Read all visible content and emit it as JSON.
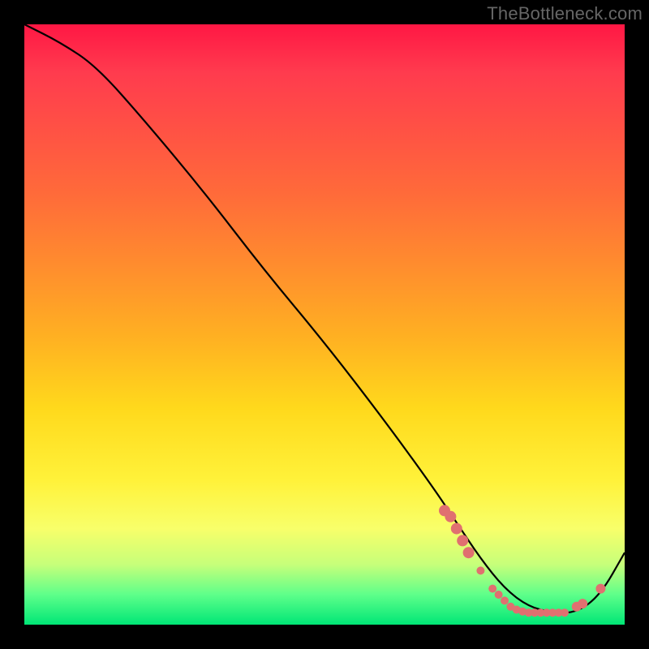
{
  "watermark": "TheBottleneck.com",
  "chart_data": {
    "type": "line",
    "title": "",
    "xlabel": "",
    "ylabel": "",
    "xlim": [
      0,
      100
    ],
    "ylim": [
      0,
      100
    ],
    "grid": false,
    "series": [
      {
        "name": "curve",
        "x": [
          0,
          6,
          12,
          20,
          30,
          40,
          50,
          60,
          68,
          72,
          76,
          80,
          84,
          88,
          92,
          96,
          100
        ],
        "y": [
          100,
          97,
          93,
          84,
          72,
          59,
          47,
          34,
          23,
          17,
          11,
          6,
          3,
          2,
          2,
          5,
          12
        ]
      }
    ],
    "markers": {
      "name": "highlight-dots",
      "x": [
        70,
        71,
        72,
        73,
        74,
        76,
        78,
        79,
        80,
        81,
        82,
        83,
        84,
        85,
        86,
        87,
        88,
        89,
        90,
        92,
        93,
        96
      ],
      "y": [
        19,
        18,
        16,
        14,
        12,
        9,
        6,
        5,
        4,
        3,
        2.5,
        2.2,
        2,
        2,
        2,
        2,
        2,
        2,
        2,
        3,
        3.5,
        6
      ]
    }
  }
}
